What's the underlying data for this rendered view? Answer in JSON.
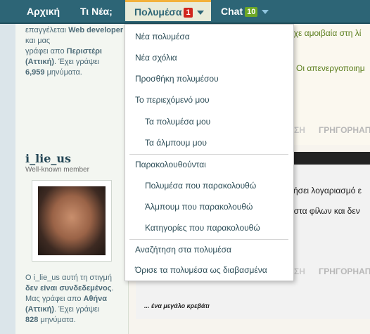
{
  "nav": {
    "home": "Αρχική",
    "whats_new": "Τι Νέα;",
    "media": "Πολυμέσα",
    "media_badge": "1",
    "chat": "Chat",
    "chat_badge": "10"
  },
  "sidebar": {
    "prev_user_lines": [
      "επαγγέλεται",
      "Web developer",
      "και μας",
      "γράφει απο",
      "Περιστέρι (Αττική)",
      ". Έχει γράψει",
      "6,959",
      "μηνύματα."
    ],
    "username": "i_lie_us",
    "user_title": "Well-known member",
    "status_lines": [
      "Ο",
      "i_lie_us",
      "αυτή τη στιγμή",
      "δεν είναι συνδεδεμένος",
      ".",
      "Μας γράφει απο",
      "Αθήνα (Αττική)",
      ". Έχει γράψει",
      "828",
      "μηνύματα."
    ]
  },
  "content": {
    "green_line1": "ίχε αμοιβαία στη λί",
    "green_line2": "Οι απενεργοποιημ",
    "share1": "ΣΗ",
    "grigora1": "ΓΡΗΓΟΡΗΑΠ",
    "black_line1": "ήσει λογαριασμό ε",
    "black_line2": "λίστα φίλων και δεν",
    "share2": "ΣΗ",
    "grigora2": "ΓΡΗΓΟΡΗΑΠ",
    "caption": "... ένα μεγάλο κρεβάτι"
  },
  "menu": {
    "items": [
      {
        "label": "Νέα πολυμέσα"
      },
      {
        "label": "Νέα σχόλια"
      },
      {
        "label": "Προσθήκη πολυμέσου"
      },
      {
        "label": "Το περιεχόμενό μου"
      },
      {
        "label": "Τα πολυμέσα μου"
      },
      {
        "label": "Τα άλμπουμ μου"
      },
      {
        "label": "Παρακολουθούνται"
      },
      {
        "label": "Πολυμέσα που παρακολουθώ"
      },
      {
        "label": "Άλμπουμ που παρακολουθώ"
      },
      {
        "label": "Κατηγορίες που παρακολουθώ"
      },
      {
        "label": "Αναζήτηση στα πολυμέσα"
      },
      {
        "label": "Όρισε τα πολυμέσα ως διαβασμένα"
      }
    ]
  }
}
